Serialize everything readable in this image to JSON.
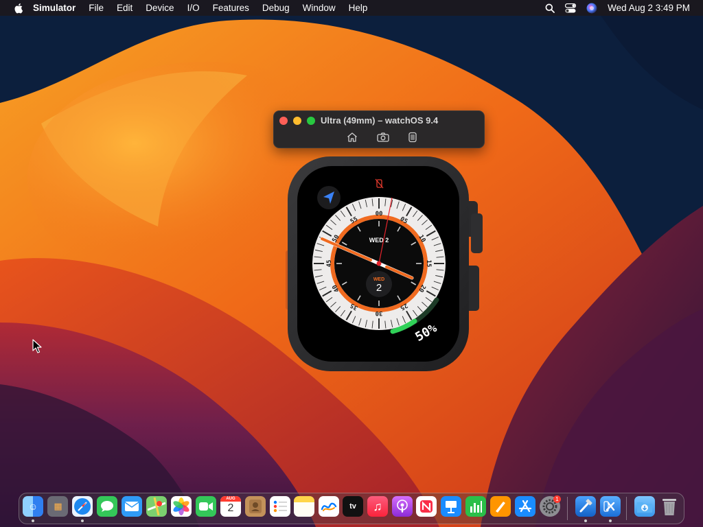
{
  "menubar": {
    "app_name": "Simulator",
    "items": [
      "File",
      "Edit",
      "Device",
      "I/O",
      "Features",
      "Debug",
      "Window",
      "Help"
    ],
    "clock": "Wed Aug 2  3:49 PM"
  },
  "simulator": {
    "title": "Ultra (49mm) – watchOS 9.4",
    "toolbar_icons": [
      "home-icon",
      "screenshot-icon",
      "rotate-icon"
    ]
  },
  "watch": {
    "bezel_numbers": [
      "00",
      "05",
      "10",
      "15",
      "20",
      "25",
      "30",
      "35",
      "40",
      "45",
      "50",
      "55"
    ],
    "top_date": "WED 2",
    "sub_day": "WED",
    "sub_date": "2",
    "battery": "50%",
    "battery_level": 0.5,
    "accent": "#f06a1f"
  },
  "dock": {
    "apps": [
      "Finder",
      "Launchpad",
      "Safari",
      "Messages",
      "Mail",
      "Maps",
      "Photos",
      "FaceTime",
      "Calendar",
      "Contacts",
      "Reminders",
      "Notes",
      "Freeform",
      "TV",
      "Music",
      "Podcasts",
      "News",
      "Keynote",
      "Numbers",
      "Pages",
      "App Store",
      "System Settings",
      "Xcode",
      "Simulator",
      "Downloads",
      "Trash"
    ],
    "calendar_month": "AUG",
    "calendar_day": "2",
    "settings_badge": "1"
  }
}
